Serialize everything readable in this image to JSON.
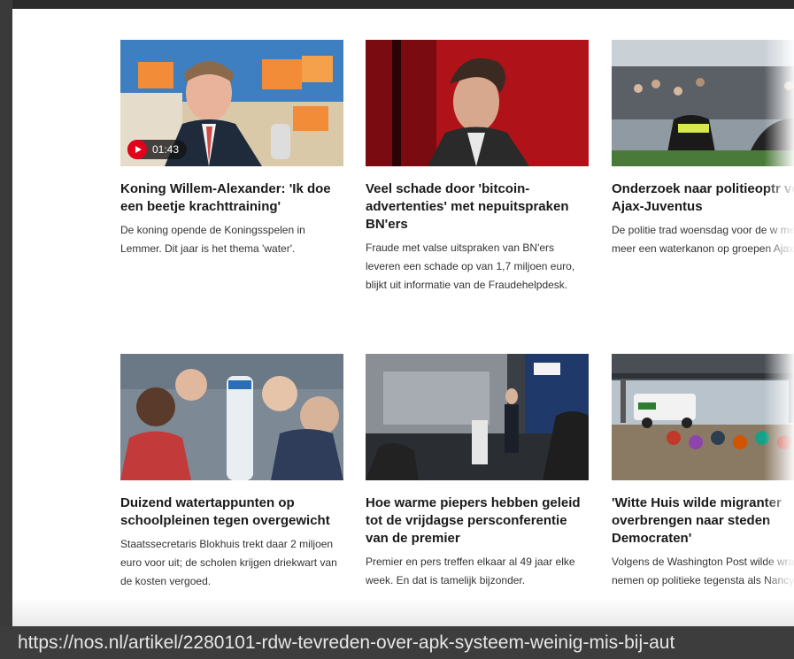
{
  "articles": [
    {
      "title": "Koning Willem-Alexander: 'Ik doe een beetje krachttraining'",
      "description": "De koning opende de Koningsspelen in Lemmer. Dit jaar is het thema 'water'.",
      "video_duration": "01:43"
    },
    {
      "title": "Veel schade door 'bitcoin-advertenties' met nepuitspraken BN'ers",
      "description": "Fraude met valse uitspraken van BN'ers leveren een schade op van 1,7 miljoen euro, blijkt uit informatie van de Fraudehelpdesk."
    },
    {
      "title": "Onderzoek naar politieoptr voor Ajax-Juventus",
      "description": "De politie trad woensdag voor de w met onder meer een waterkanon op groepen Ajax-fans."
    },
    {
      "title": "Duizend watertappunten op schoolpleinen tegen overgewicht",
      "description": "Staatssecretaris Blokhuis trekt daar 2 miljoen euro voor uit; de scholen krijgen driekwart van de kosten vergoed."
    },
    {
      "title": "Hoe warme piepers hebben geleid tot de vrijdagse persconferentie van de premier",
      "description": "Premier en pers treffen elkaar al 49 jaar elke week. En dat is tamelijk bijzonder."
    },
    {
      "title": "'Witte Huis wilde migranter overbrengen naar steden Democraten'",
      "description": "Volgens de Washington Post wilde wraak nemen op politieke tegensta als Nancy Pelosi."
    }
  ],
  "status_bar": {
    "url": "https://nos.nl/artikel/2280101-rdw-tevreden-over-apk-systeem-weinig-mis-bij-aut"
  }
}
